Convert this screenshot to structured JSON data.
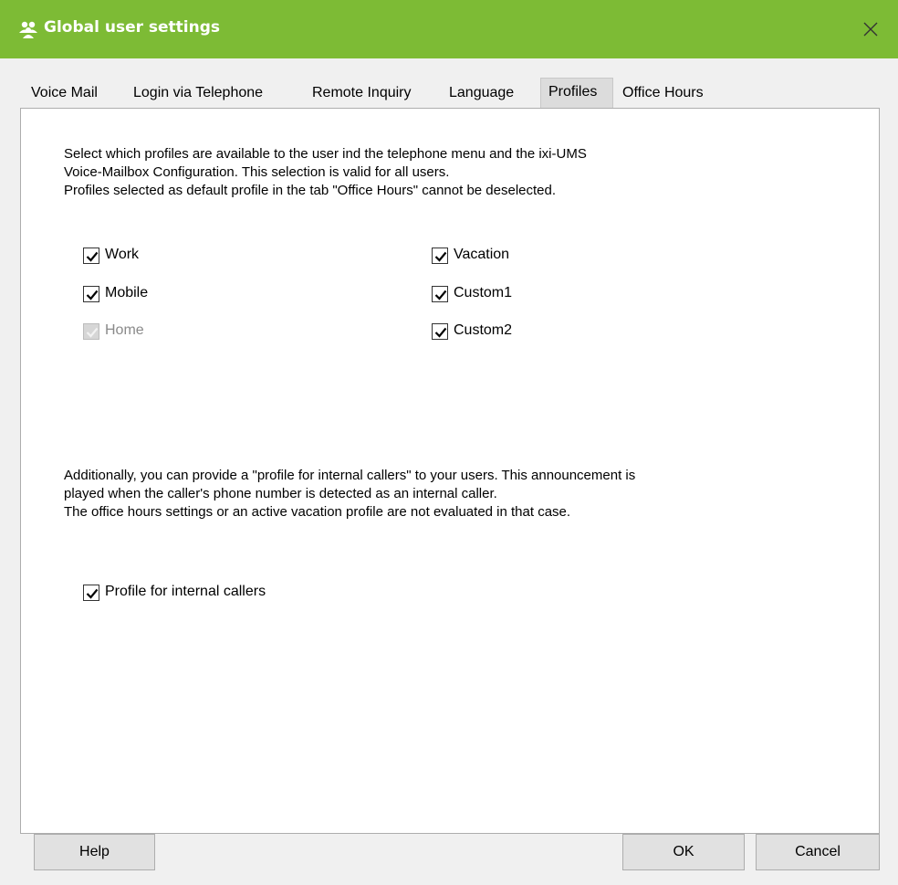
{
  "window": {
    "title": "Global user settings",
    "title_icon": "users-icon",
    "accent": "#7dbb35"
  },
  "tabs": [
    {
      "label": "Voice Mail",
      "active": false
    },
    {
      "label": "Login via Telephone",
      "active": false
    },
    {
      "label": "Remote Inquiry",
      "active": false
    },
    {
      "label": "Language",
      "active": false
    },
    {
      "label": "Profiles",
      "active": true
    },
    {
      "label": "Office Hours",
      "active": false
    }
  ],
  "profiles_intro": [
    "Select which profiles are available to the user ind the telephone menu and the ixi-UMS",
    "Voice-Mailbox Configuration. This selection is valid for all users.",
    "Profiles selected as default profile in the tab \"Office Hours\" cannot be deselected."
  ],
  "profiles": [
    {
      "label": "Work",
      "checked": true,
      "enabled": true
    },
    {
      "label": "Mobile",
      "checked": true,
      "enabled": true
    },
    {
      "label": "Home",
      "checked": true,
      "enabled": false
    },
    {
      "label": "Vacation",
      "checked": true,
      "enabled": true
    },
    {
      "label": "Custom1",
      "checked": true,
      "enabled": true
    },
    {
      "label": "Custom2",
      "checked": true,
      "enabled": true
    }
  ],
  "internal_intro": [
    "Additionally, you can provide a \"profile for internal callers\" to your users. This announcement is",
    "played when the caller's phone number is detected as an internal caller.",
    "The office hours settings or an active vacation profile are not evaluated in that case."
  ],
  "internal_profile": {
    "label": "Profile for internal callers",
    "checked": true
  },
  "buttons": {
    "help": "Help",
    "ok": "OK",
    "cancel": "Cancel"
  }
}
